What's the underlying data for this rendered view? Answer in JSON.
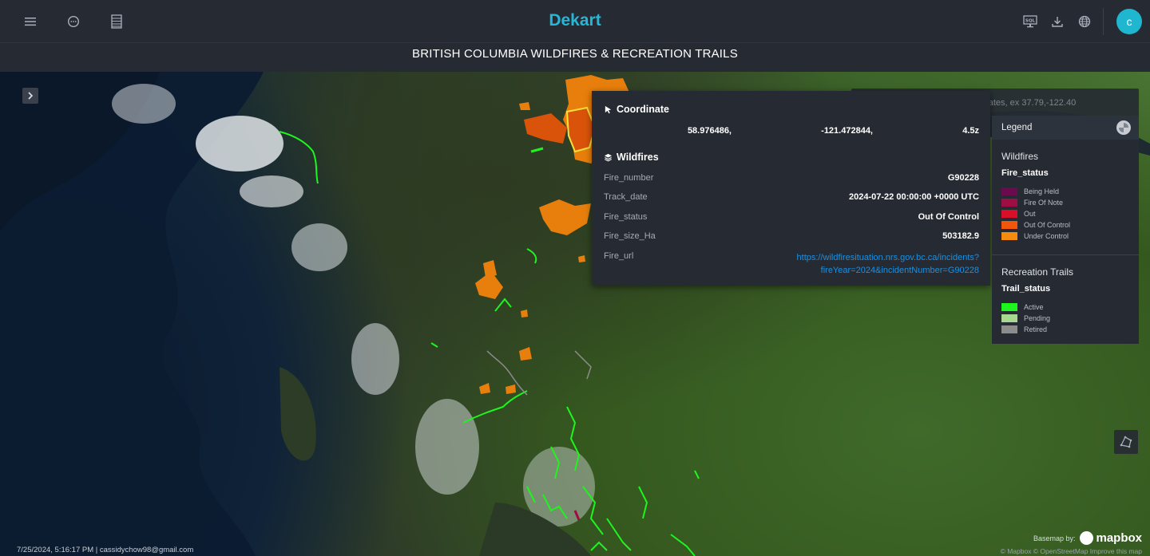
{
  "header": {
    "brand": "Dekart",
    "title": "BRITISH COLUMBIA WILDFIRES & RECREATION TRAILS",
    "avatar_letter": "c",
    "left_icons": [
      "menu-icon",
      "chat-icon",
      "list-icon"
    ],
    "right_icons": [
      "sql-icon",
      "download-icon",
      "globe-icon"
    ]
  },
  "search": {
    "placeholder": "Enter an address or coordinates, ex 37.79,-122.40"
  },
  "tooltip": {
    "coordinate_heading": "Coordinate",
    "lat": "58.976486,",
    "lng": "-121.472844,",
    "zoom": "4.5z",
    "layer_heading": "Wildfires",
    "rows": [
      {
        "key": "Fire_number",
        "value": "G90228"
      },
      {
        "key": "Track_date",
        "value": "2024-07-22 00:00:00 +0000 UTC"
      },
      {
        "key": "Fire_status",
        "value": "Out Of Control"
      },
      {
        "key": "Fire_size_Ha",
        "value": "503182.9"
      }
    ],
    "url_key": "Fire_url",
    "url_line1": "https://wildfiresituation.nrs.gov.bc.ca/incidents?",
    "url_line2": "fireYear=2024&incidentNumber=G90228"
  },
  "legend": {
    "heading": "Legend",
    "sections": [
      {
        "layer": "Wildfires",
        "field": "Fire_status",
        "items": [
          {
            "label": "Being Held",
            "color": "#6b0b4f"
          },
          {
            "label": "Fire Of Note",
            "color": "#a00c44"
          },
          {
            "label": "Out",
            "color": "#d90f2a"
          },
          {
            "label": "Out Of Control",
            "color": "#f2560a"
          },
          {
            "label": "Under Control",
            "color": "#f58c0f"
          }
        ]
      },
      {
        "layer": "Recreation Trails",
        "field": "Trail_status",
        "items": [
          {
            "label": "Active",
            "color": "#1ef41e"
          },
          {
            "label": "Pending",
            "color": "#a6d98f"
          },
          {
            "label": "Retired",
            "color": "#8c8c8c"
          }
        ]
      }
    ]
  },
  "footer": {
    "timestamp": "7/25/2024, 5:16:17 PM | cassidychow98@gmail.com",
    "basemap_label": "Basemap by:",
    "mapbox": "mapbox",
    "credits": "© Mapbox © OpenStreetMap  Improve this map"
  }
}
